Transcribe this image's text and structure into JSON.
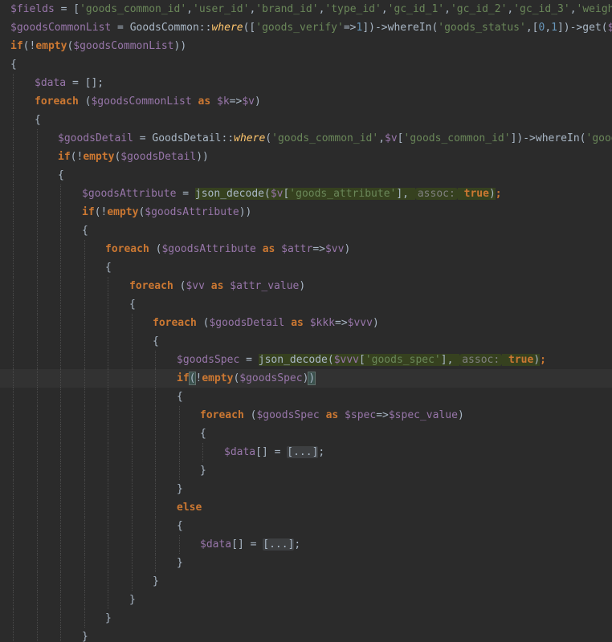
{
  "editor": {
    "language": "php",
    "theme": "dark",
    "current_line_index": 20,
    "lines": [
      {
        "indent": 0,
        "tokens": [
          {
            "t": "$fields",
            "c": "var"
          },
          {
            "t": " = [",
            "c": "plain"
          },
          {
            "t": "'goods_common_id'",
            "c": "str"
          },
          {
            "t": ",",
            "c": "plain"
          },
          {
            "t": "'user_id'",
            "c": "str"
          },
          {
            "t": ",",
            "c": "plain"
          },
          {
            "t": "'brand_id'",
            "c": "str"
          },
          {
            "t": ",",
            "c": "plain"
          },
          {
            "t": "'type_id'",
            "c": "str"
          },
          {
            "t": ",",
            "c": "plain"
          },
          {
            "t": "'gc_id_1'",
            "c": "str"
          },
          {
            "t": ",",
            "c": "plain"
          },
          {
            "t": "'gc_id_2'",
            "c": "str"
          },
          {
            "t": ",",
            "c": "plain"
          },
          {
            "t": "'gc_id_3'",
            "c": "str"
          },
          {
            "t": ",",
            "c": "plain"
          },
          {
            "t": "'weight_id'",
            "c": "str"
          },
          {
            "t": ",",
            "c": "plain"
          }
        ]
      },
      {
        "indent": 0,
        "tokens": [
          {
            "t": "$goodsCommonList",
            "c": "var"
          },
          {
            "t": " = GoodsCommon::",
            "c": "plain"
          },
          {
            "t": "where",
            "c": "static"
          },
          {
            "t": "([",
            "c": "plain"
          },
          {
            "t": "'goods_verify'",
            "c": "str"
          },
          {
            "t": "=>",
            "c": "plain"
          },
          {
            "t": "1",
            "c": "num"
          },
          {
            "t": "])->",
            "c": "plain"
          },
          {
            "t": "whereIn",
            "c": "method"
          },
          {
            "t": "(",
            "c": "plain"
          },
          {
            "t": "'goods_status'",
            "c": "str"
          },
          {
            "t": ",[",
            "c": "plain"
          },
          {
            "t": "0",
            "c": "num"
          },
          {
            "t": ",",
            "c": "plain"
          },
          {
            "t": "1",
            "c": "num"
          },
          {
            "t": "])->",
            "c": "plain"
          },
          {
            "t": "get",
            "c": "method"
          },
          {
            "t": "(",
            "c": "plain"
          },
          {
            "t": "$fields",
            "c": "var"
          }
        ]
      },
      {
        "indent": 0,
        "tokens": [
          {
            "t": "if",
            "c": "kw"
          },
          {
            "t": "(!",
            "c": "plain"
          },
          {
            "t": "empty",
            "c": "kw"
          },
          {
            "t": "(",
            "c": "plain"
          },
          {
            "t": "$goodsCommonList",
            "c": "var"
          },
          {
            "t": "))",
            "c": "plain"
          }
        ]
      },
      {
        "indent": 0,
        "tokens": [
          {
            "t": "{",
            "c": "plain"
          }
        ]
      },
      {
        "indent": 1,
        "tokens": [
          {
            "t": "$data",
            "c": "var"
          },
          {
            "t": " = [];",
            "c": "plain"
          }
        ]
      },
      {
        "indent": 1,
        "tokens": [
          {
            "t": "foreach",
            "c": "kw"
          },
          {
            "t": " (",
            "c": "plain"
          },
          {
            "t": "$goodsCommonList",
            "c": "var"
          },
          {
            "t": " ",
            "c": "plain"
          },
          {
            "t": "as",
            "c": "kw"
          },
          {
            "t": " ",
            "c": "plain"
          },
          {
            "t": "$k",
            "c": "var"
          },
          {
            "t": "=>",
            "c": "plain"
          },
          {
            "t": "$v",
            "c": "var"
          },
          {
            "t": ")",
            "c": "plain"
          }
        ]
      },
      {
        "indent": 1,
        "tokens": [
          {
            "t": "{",
            "c": "plain"
          }
        ]
      },
      {
        "indent": 2,
        "tokens": [
          {
            "t": "$goodsDetail",
            "c": "var"
          },
          {
            "t": " = GoodsDetail::",
            "c": "plain"
          },
          {
            "t": "where",
            "c": "static"
          },
          {
            "t": "(",
            "c": "plain"
          },
          {
            "t": "'goods_common_id'",
            "c": "str"
          },
          {
            "t": ",",
            "c": "plain"
          },
          {
            "t": "$v",
            "c": "var"
          },
          {
            "t": "[",
            "c": "plain"
          },
          {
            "t": "'goods_common_id'",
            "c": "str"
          },
          {
            "t": "])->",
            "c": "plain"
          },
          {
            "t": "whereIn",
            "c": "method"
          },
          {
            "t": "(",
            "c": "plain"
          },
          {
            "t": "'goods_sta",
            "c": "str"
          }
        ]
      },
      {
        "indent": 2,
        "tokens": [
          {
            "t": "if",
            "c": "kw"
          },
          {
            "t": "(!",
            "c": "plain"
          },
          {
            "t": "empty",
            "c": "kw"
          },
          {
            "t": "(",
            "c": "plain"
          },
          {
            "t": "$goodsDetail",
            "c": "var"
          },
          {
            "t": "))",
            "c": "plain"
          }
        ]
      },
      {
        "indent": 2,
        "tokens": [
          {
            "t": "{",
            "c": "plain"
          }
        ]
      },
      {
        "indent": 3,
        "tokens": [
          {
            "t": "$goodsAttribute",
            "c": "var"
          },
          {
            "t": " = ",
            "c": "plain"
          },
          {
            "t": "json_decode(",
            "c": "plain",
            "hl": true
          },
          {
            "t": "$v",
            "c": "var",
            "hl": true
          },
          {
            "t": "[",
            "c": "plain",
            "hl": true
          },
          {
            "t": "'goods_attribute'",
            "c": "str",
            "hl": true
          },
          {
            "t": "], ",
            "c": "plain",
            "hl": true
          },
          {
            "t": "assoc:",
            "c": "hint",
            "hl": true
          },
          {
            "t": " ",
            "c": "plain",
            "hl": true
          },
          {
            "t": "true",
            "c": "kw",
            "hl": true
          },
          {
            "t": ")",
            "c": "plain",
            "hl": true
          },
          {
            "t": ";",
            "c": "kw"
          }
        ]
      },
      {
        "indent": 3,
        "tokens": [
          {
            "t": "if",
            "c": "kw"
          },
          {
            "t": "(!",
            "c": "plain"
          },
          {
            "t": "empty",
            "c": "kw"
          },
          {
            "t": "(",
            "c": "plain"
          },
          {
            "t": "$goodsAttribute",
            "c": "var"
          },
          {
            "t": "))",
            "c": "plain"
          }
        ]
      },
      {
        "indent": 3,
        "tokens": [
          {
            "t": "{",
            "c": "plain"
          }
        ]
      },
      {
        "indent": 4,
        "tokens": [
          {
            "t": "foreach",
            "c": "kw"
          },
          {
            "t": " (",
            "c": "plain"
          },
          {
            "t": "$goodsAttribute",
            "c": "var"
          },
          {
            "t": " ",
            "c": "plain"
          },
          {
            "t": "as",
            "c": "kw"
          },
          {
            "t": " ",
            "c": "plain"
          },
          {
            "t": "$attr",
            "c": "var"
          },
          {
            "t": "=>",
            "c": "plain"
          },
          {
            "t": "$vv",
            "c": "var"
          },
          {
            "t": ")",
            "c": "plain"
          }
        ]
      },
      {
        "indent": 4,
        "tokens": [
          {
            "t": "{",
            "c": "plain"
          }
        ]
      },
      {
        "indent": 5,
        "tokens": [
          {
            "t": "foreach",
            "c": "kw"
          },
          {
            "t": " (",
            "c": "plain"
          },
          {
            "t": "$vv",
            "c": "var"
          },
          {
            "t": " ",
            "c": "plain"
          },
          {
            "t": "as",
            "c": "kw"
          },
          {
            "t": " ",
            "c": "plain"
          },
          {
            "t": "$attr_value",
            "c": "var"
          },
          {
            "t": ")",
            "c": "plain"
          }
        ]
      },
      {
        "indent": 5,
        "tokens": [
          {
            "t": "{",
            "c": "plain"
          }
        ]
      },
      {
        "indent": 6,
        "tokens": [
          {
            "t": "foreach",
            "c": "kw"
          },
          {
            "t": " (",
            "c": "plain"
          },
          {
            "t": "$goodsDetail",
            "c": "var"
          },
          {
            "t": " ",
            "c": "plain"
          },
          {
            "t": "as",
            "c": "kw"
          },
          {
            "t": " ",
            "c": "plain"
          },
          {
            "t": "$kkk",
            "c": "var"
          },
          {
            "t": "=>",
            "c": "plain"
          },
          {
            "t": "$vvv",
            "c": "var"
          },
          {
            "t": ")",
            "c": "plain"
          }
        ]
      },
      {
        "indent": 6,
        "tokens": [
          {
            "t": "{",
            "c": "plain"
          }
        ]
      },
      {
        "indent": 7,
        "tokens": [
          {
            "t": "$goodsSpec",
            "c": "var"
          },
          {
            "t": " = ",
            "c": "plain"
          },
          {
            "t": "json_decode(",
            "c": "plain",
            "hl": true
          },
          {
            "t": "$vvv",
            "c": "var",
            "hl": true
          },
          {
            "t": "[",
            "c": "plain",
            "hl": true
          },
          {
            "t": "'goods_spec'",
            "c": "str",
            "hl": true
          },
          {
            "t": "], ",
            "c": "plain",
            "hl": true
          },
          {
            "t": "assoc:",
            "c": "hint",
            "hl": true
          },
          {
            "t": " ",
            "c": "plain",
            "hl": true
          },
          {
            "t": "true",
            "c": "kw",
            "hl": true
          },
          {
            "t": ")",
            "c": "plain",
            "hl": true
          },
          {
            "t": ";",
            "c": "kw"
          }
        ]
      },
      {
        "indent": 7,
        "tokens": [
          {
            "t": "if",
            "c": "kw"
          },
          {
            "t": "(",
            "c": "plain",
            "brace": true
          },
          {
            "t": "!",
            "c": "plain"
          },
          {
            "t": "empty",
            "c": "kw"
          },
          {
            "t": "(",
            "c": "plain"
          },
          {
            "t": "$goodsSpec",
            "c": "var"
          },
          {
            "t": ")",
            "c": "plain"
          },
          {
            "t": ")",
            "c": "plain",
            "brace": true,
            "caret": true
          }
        ]
      },
      {
        "indent": 7,
        "tokens": [
          {
            "t": "{",
            "c": "plain"
          }
        ]
      },
      {
        "indent": 8,
        "tokens": [
          {
            "t": "foreach",
            "c": "kw"
          },
          {
            "t": " (",
            "c": "plain"
          },
          {
            "t": "$goodsSpec",
            "c": "var"
          },
          {
            "t": " ",
            "c": "plain"
          },
          {
            "t": "as",
            "c": "kw"
          },
          {
            "t": " ",
            "c": "plain"
          },
          {
            "t": "$spec",
            "c": "var"
          },
          {
            "t": "=>",
            "c": "plain"
          },
          {
            "t": "$spec_value",
            "c": "var"
          },
          {
            "t": ")",
            "c": "plain"
          }
        ]
      },
      {
        "indent": 8,
        "tokens": [
          {
            "t": "{",
            "c": "plain"
          }
        ]
      },
      {
        "indent": 9,
        "tokens": [
          {
            "t": "$data",
            "c": "var"
          },
          {
            "t": "[] = ",
            "c": "plain"
          },
          {
            "t": "[...]",
            "c": "fold"
          },
          {
            "t": ";",
            "c": "plain"
          }
        ]
      },
      {
        "indent": 8,
        "tokens": [
          {
            "t": "}",
            "c": "plain"
          }
        ]
      },
      {
        "indent": 7,
        "tokens": [
          {
            "t": "}",
            "c": "plain"
          }
        ]
      },
      {
        "indent": 7,
        "tokens": [
          {
            "t": "else",
            "c": "kw"
          }
        ]
      },
      {
        "indent": 7,
        "tokens": [
          {
            "t": "{",
            "c": "plain"
          }
        ]
      },
      {
        "indent": 8,
        "tokens": [
          {
            "t": "$data",
            "c": "var"
          },
          {
            "t": "[] = ",
            "c": "plain"
          },
          {
            "t": "[...]",
            "c": "fold"
          },
          {
            "t": ";",
            "c": "plain"
          }
        ]
      },
      {
        "indent": 7,
        "tokens": [
          {
            "t": "}",
            "c": "plain"
          }
        ]
      },
      {
        "indent": 6,
        "tokens": [
          {
            "t": "}",
            "c": "plain"
          }
        ]
      },
      {
        "indent": 5,
        "tokens": [
          {
            "t": "}",
            "c": "plain"
          }
        ]
      },
      {
        "indent": 4,
        "tokens": [
          {
            "t": "}",
            "c": "plain"
          }
        ]
      },
      {
        "indent": 3,
        "tokens": [
          {
            "t": "}",
            "c": "plain"
          }
        ]
      }
    ]
  }
}
